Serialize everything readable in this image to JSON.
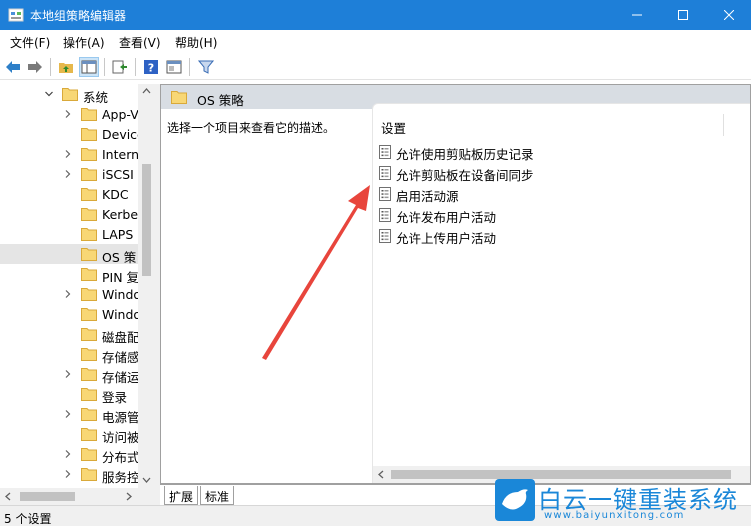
{
  "window": {
    "title": "本地组策略编辑器",
    "controls": {
      "minimize": "minimize",
      "maximize": "maximize",
      "close": "close"
    }
  },
  "menu": [
    {
      "label": "文件(F)"
    },
    {
      "label": "操作(A)"
    },
    {
      "label": "查看(V)"
    },
    {
      "label": "帮助(H)"
    }
  ],
  "toolbar": {
    "icons": [
      "back-icon",
      "forward-icon",
      "up-folder-icon",
      "show-hide-tree-icon",
      "export-icon",
      "help-icon",
      "properties-icon",
      "filter-icon"
    ]
  },
  "tree": {
    "parent": {
      "label": "系统",
      "expanded": true
    },
    "items": [
      {
        "label": "App-V",
        "expandable": true
      },
      {
        "label": "Device",
        "expandable": false
      },
      {
        "label": "Intern",
        "expandable": true
      },
      {
        "label": "iSCSI",
        "expandable": true
      },
      {
        "label": "KDC",
        "expandable": false
      },
      {
        "label": "Kerbe",
        "expandable": false
      },
      {
        "label": "LAPS",
        "expandable": false
      },
      {
        "label": "OS 策",
        "expandable": false,
        "selected": true
      },
      {
        "label": "PIN 复",
        "expandable": false
      },
      {
        "label": "Windo",
        "expandable": true
      },
      {
        "label": "Windo",
        "expandable": false
      },
      {
        "label": "磁盘配",
        "expandable": false
      },
      {
        "label": "存储感",
        "expandable": false
      },
      {
        "label": "存储运",
        "expandable": true
      },
      {
        "label": "登录",
        "expandable": false
      },
      {
        "label": "电源管",
        "expandable": true
      },
      {
        "label": "访问被",
        "expandable": false
      },
      {
        "label": "分布式",
        "expandable": true
      },
      {
        "label": "服务控",
        "expandable": true
      }
    ]
  },
  "pane": {
    "title": "OS 策略",
    "description": "选择一个项目来查看它的描述。",
    "column_header": "设置",
    "settings": [
      {
        "label": "允许使用剪贴板历史记录"
      },
      {
        "label": "允许剪贴板在设备间同步"
      },
      {
        "label": "启用活动源"
      },
      {
        "label": "允许发布用户活动"
      },
      {
        "label": "允许上传用户活动"
      }
    ]
  },
  "tabs": [
    {
      "label": "扩展"
    },
    {
      "label": "标准"
    }
  ],
  "status": "5 个设置",
  "watermark": {
    "title": "白云一键重装系统",
    "url": "www.baiyunxitong.com"
  },
  "colors": {
    "titlebar": "#1e7fd8",
    "folder": "#f2c55c",
    "selection": "#e5e5e5",
    "arrow": "#e8453c",
    "watermark": "#1a87d8"
  }
}
